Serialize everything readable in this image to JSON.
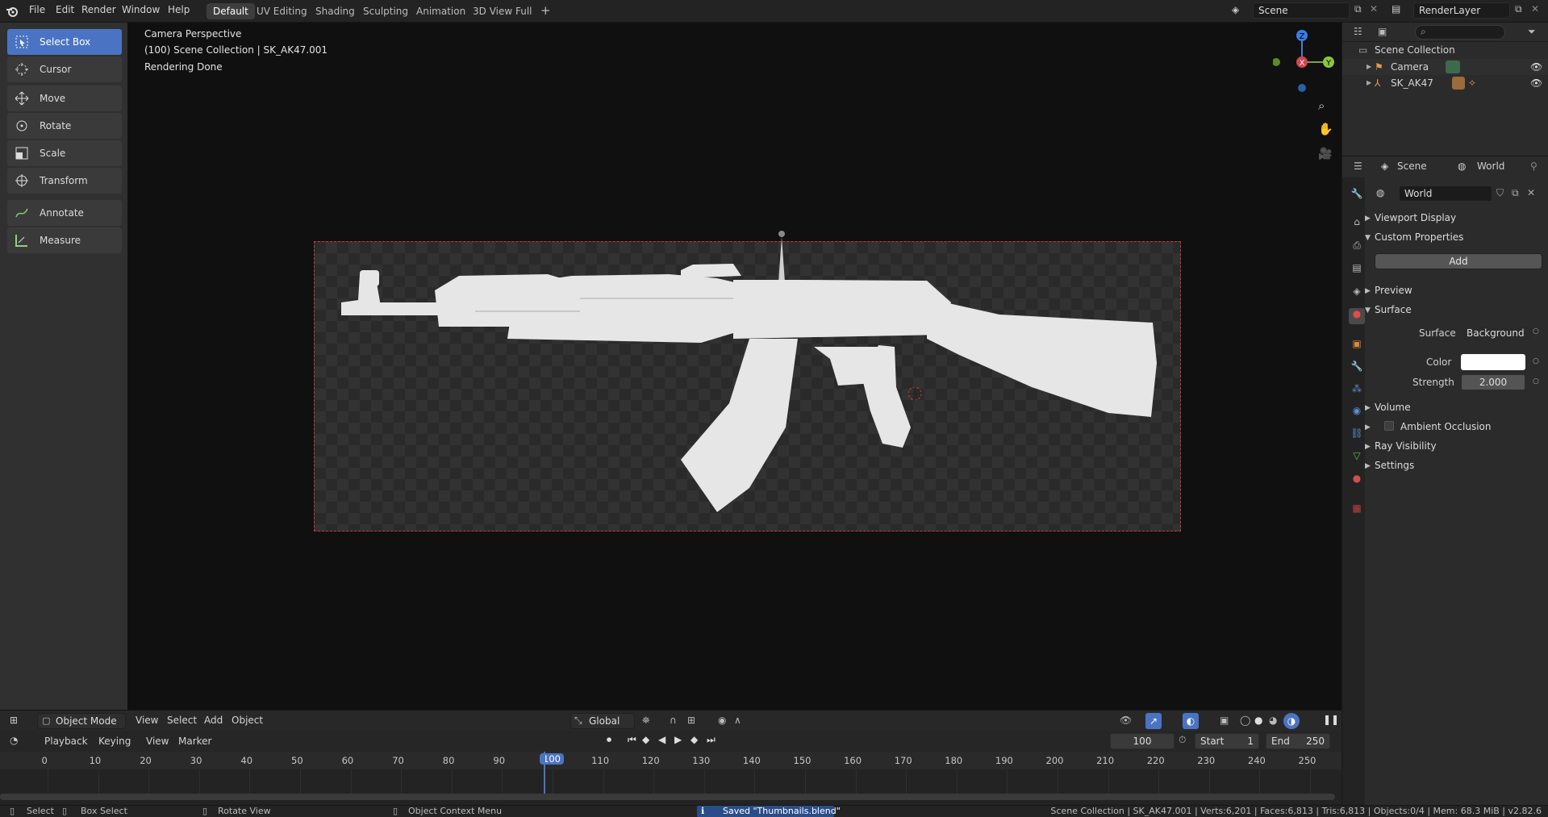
{
  "topbar": {
    "menus": [
      "File",
      "Edit",
      "Render",
      "Window",
      "Help"
    ],
    "workspaces": [
      "Default",
      "UV Editing",
      "Shading",
      "Sculpting",
      "Animation",
      "3D View Full"
    ],
    "active_workspace": "Default",
    "scene_name": "Scene",
    "view_layer": "RenderLayer"
  },
  "toolbar": {
    "tools": [
      "Select Box",
      "Cursor",
      "Move",
      "Rotate",
      "Scale",
      "Transform",
      "Annotate",
      "Measure"
    ],
    "active": "Select Box"
  },
  "viewport": {
    "info": [
      "Camera Perspective",
      "(100) Scene Collection | SK_AK47.001",
      "Rendering Done"
    ],
    "gizmo": {
      "z": "Z",
      "x": "X",
      "y": "Y"
    }
  },
  "outliner": {
    "root": "Scene Collection",
    "items": [
      "Camera",
      "SK_AK47"
    ]
  },
  "properties": {
    "breadcrumb": [
      "Scene",
      "World"
    ],
    "world_name": "World",
    "sections": {
      "viewport_display": "Viewport Display",
      "custom_properties": "Custom Properties",
      "add": "Add",
      "preview": "Preview",
      "surface": "Surface",
      "volume": "Volume",
      "ambient_occlusion": "Ambient Occlusion",
      "ray_visibility": "Ray Visibility",
      "settings": "Settings"
    },
    "surface_label": "Surface",
    "surface_value": "Background",
    "color_label": "Color",
    "color_value": "#ffffff",
    "strength_label": "Strength",
    "strength_value": "2.000"
  },
  "view_header": {
    "mode": "Object Mode",
    "menus": [
      "View",
      "Select",
      "Add",
      "Object"
    ],
    "orientation": "Global"
  },
  "timeline_header": {
    "menus": [
      "Playback",
      "Keying",
      "View",
      "Marker"
    ],
    "current_frame": "100",
    "start_label": "Start",
    "start": "1",
    "end_label": "End",
    "end": "250"
  },
  "ruler": {
    "ticks": [
      "0",
      "10",
      "20",
      "30",
      "40",
      "50",
      "60",
      "70",
      "80",
      "90",
      "100",
      "110",
      "120",
      "130",
      "140",
      "150",
      "160",
      "170",
      "180",
      "190",
      "200",
      "210",
      "220",
      "230",
      "240",
      "250"
    ],
    "current": "100"
  },
  "statusbar": {
    "select": "Select",
    "box_select": "Box Select",
    "rotate_view": "Rotate View",
    "context_menu": "Object Context Menu",
    "saved": "Saved \"Thumbnails.blend\"",
    "stats": "Scene Collection | SK_AK47.001 | Verts:6,201 | Faces:6,813 | Tris:6,813 | Objects:0/4 | Mem: 68.3 MiB | v2.82.6"
  }
}
